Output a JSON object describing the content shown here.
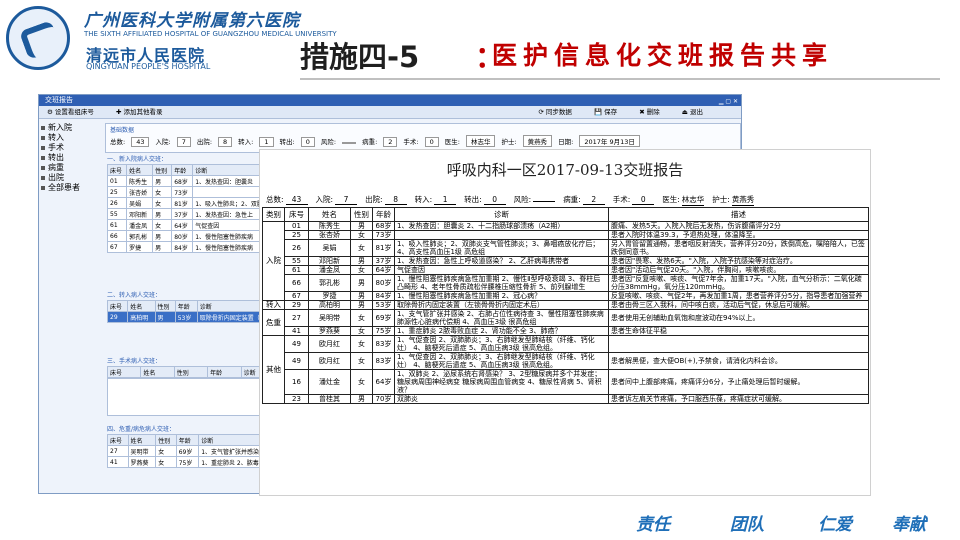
{
  "header": {
    "hospital_cn": "广州医科大学附属第六医院",
    "hospital_en": "THE SIXTH AFFILIATED HOSPITAL OF GUANGZHOU MEDICAL UNIVERSITY",
    "hospital_cn2": "清远市人民医院",
    "hospital_en2": "QINGYUAN PEOPLE'S HOSPITAL",
    "title_main": "措施四-5",
    "title_colon": "：",
    "title_sub": "医护信息化交班报告共享"
  },
  "app": {
    "window_title": "交班报告",
    "toolbar": {
      "set_bed": "设置看组床号",
      "add_content": "添加其他看录"
    },
    "toolbar_right": {
      "sync": "同步数据",
      "save": "保存",
      "delete": "删除",
      "close": "退出"
    },
    "tree": [
      "新入院",
      "转入",
      "手术",
      "转出",
      "病重",
      "出院",
      "全部患者"
    ],
    "stats_label": "基础数据",
    "stats": [
      {
        "label": "总数:",
        "value": "43"
      },
      {
        "label": "入院:",
        "value": "7"
      },
      {
        "label": "出院:",
        "value": "8"
      },
      {
        "label": "转入:",
        "value": "1"
      },
      {
        "label": "转出:",
        "value": "0"
      },
      {
        "label": "风险:",
        "value": ""
      },
      {
        "label": "病重:",
        "value": "2"
      },
      {
        "label": "手术:",
        "value": "0"
      },
      {
        "label": "医生:",
        "value": "林志华"
      },
      {
        "label": "护士:",
        "value": "黄燕秀"
      },
      {
        "label": "日期:",
        "value": "2017年 9月13日"
      }
    ],
    "sec1": {
      "title": "一、新入院病人交班：",
      "headers": [
        "床号",
        "姓名",
        "性别",
        "年龄",
        "诊断"
      ],
      "rows": [
        [
          "01",
          "陈秀生",
          "男",
          "68岁",
          "1、发热查因：胆囊炎"
        ],
        [
          "25",
          "张杏娇",
          "女",
          "73岁",
          ""
        ],
        [
          "26",
          "吴娟",
          "女",
          "81岁",
          "1、吸入性肺炎；2、双肺"
        ],
        [
          "55",
          "邓阳新",
          "男",
          "37岁",
          "1、发热查因：急性上"
        ],
        [
          "61",
          "潘金凤",
          "女",
          "64岁",
          "气促查因"
        ],
        [
          "66",
          "郭孔彬",
          "男",
          "80岁",
          "1、慢性阻塞性肺疾病"
        ],
        [
          "67",
          "罗捷",
          "男",
          "84岁",
          "1、慢性阻塞性肺疾病"
        ]
      ]
    },
    "sec2": {
      "title": "二、转入病人交班：",
      "headers": [
        "床号",
        "姓名",
        "性别",
        "年龄",
        "诊断"
      ],
      "rows": [
        [
          "29",
          "高柏明",
          "男",
          "53岁",
          "取除骨折内固定装置（"
        ]
      ]
    },
    "sec3": {
      "title": "三、手术病人交班：",
      "headers": [
        "床号",
        "姓名",
        "性别",
        "年龄",
        "诊断"
      ],
      "rows": []
    },
    "sec4": {
      "title": "四、危重/病危病人交班：",
      "headers": [
        "床号",
        "姓名",
        "性别",
        "年龄",
        "诊断"
      ],
      "rows": [
        [
          "27",
          "吴明带",
          "女",
          "69岁",
          "1、支气管扩张并感染"
        ],
        [
          "41",
          "罗燕葵",
          "女",
          "75岁",
          "1、重症肺炎 2、脓毒"
        ]
      ]
    }
  },
  "report": {
    "title": "呼吸内科一区2017-09-13交班报告",
    "stats": [
      {
        "label": "总数:",
        "value": "43"
      },
      {
        "label": "入院:",
        "value": "7"
      },
      {
        "label": "出院:",
        "value": "8"
      },
      {
        "label": "转入:",
        "value": "1"
      },
      {
        "label": "转出:",
        "value": "0"
      },
      {
        "label": "风险:",
        "value": ""
      },
      {
        "label": "病重:",
        "value": "2"
      },
      {
        "label": "手术:",
        "value": "0"
      },
      {
        "label": "医生:",
        "value": "林志华"
      },
      {
        "label": "护士:",
        "value": "黄燕秀"
      }
    ],
    "headers": [
      "类别",
      "床号",
      "姓名",
      "性别",
      "年龄",
      "诊断",
      "描述"
    ],
    "groups": [
      {
        "category": "入院",
        "rows": [
          {
            "bed": "01",
            "name": "陈秀生",
            "sex": "男",
            "age": "68岁",
            "dx": "1、发热查因：胆囊炎 2、十二指肠球部溃疡（A2期）",
            "desc": "腹痛、发热5天。入院入院后无发热，伤诉腹痛评分2分"
          },
          {
            "bed": "25",
            "name": "张杏娇",
            "sex": "女",
            "age": "73岁",
            "dx": "",
            "desc": "患者入院时体温39.3，予退热处理，体温降至。"
          },
          {
            "bed": "26",
            "name": "吴娟",
            "sex": "女",
            "age": "81岁",
            "dx": "1、吸入性肺炎；2、双肺炎支气管性肺炎；3、鼻咽癌放化疗后；4、高支性高血压1级 高危组",
            "desc": "另入胃管留置通畅，患者咽反射消失，营养评分20分，跌倒高危，嘱陪陪人，已签跌倒同意书。"
          },
          {
            "bed": "55",
            "name": "邓阳新",
            "sex": "男",
            "age": "37岁",
            "dx": "1、发热查因：急性上呼吸道感染？ 2、乙肝病毒携带者",
            "desc": "患者因\"畏寒、发热6天。\"入院，入院予抗感染等对症治疗。"
          },
          {
            "bed": "61",
            "name": "潘金凤",
            "sex": "女",
            "age": "64岁",
            "dx": "气促查因",
            "desc": "患者因\"活动后气促20天。\"入院，伴胸闷，咳嗽咳痰。"
          },
          {
            "bed": "66",
            "name": "郭孔彬",
            "sex": "男",
            "age": "80岁",
            "dx": "1、慢性阻塞性肺疾病急性加重期 2、慢性Ⅱ型呼吸衰竭 3、脊柱后凸畸形 4、老年性骨质疏松伴腰椎压缩性骨折 5、前列腺增生",
            "desc": "患者因\"反复咳嗽、咳痰、气促7年余，加重17天。\"入院，血气分析示：二氧化碳分压38mmHg，氧分压120mmHg。"
          },
          {
            "bed": "67",
            "name": "罗捷",
            "sex": "男",
            "age": "84岁",
            "dx": "1、慢性阻塞性肺疾病急性加重期 2、冠心病？",
            "desc": "反复咳嗽、咳痰、气促2年，再发加重1周，患者营养评分5分，指导患者加强营养"
          }
        ]
      },
      {
        "category": "转入",
        "rows": [
          {
            "bed": "29",
            "name": "高柏明",
            "sex": "男",
            "age": "53岁",
            "dx": "取除骨折内固定装置（左锁骨骨折内固定术后）",
            "desc": "患者由骨三区入我科，间中咳白痰，活动后气促，休息后可缓解。"
          }
        ]
      },
      {
        "category": "危重",
        "rows": [
          {
            "bed": "27",
            "name": "吴明带",
            "sex": "女",
            "age": "69岁",
            "dx": "1、支气管扩张并感染 2、右肺占位性病待查 3、慢性阻塞性肺疾病 肺源性心脏病代偿期 4、高血压3级 很高危组",
            "desc": "患者使用无创辅助血氧饱和度波动在94%以上。"
          },
          {
            "bed": "41",
            "name": "罗燕葵",
            "sex": "女",
            "age": "75岁",
            "dx": "1、重症肺炎 2脓毒败血症 2、肾功能不全 3、肺癌？",
            "desc": "患者生命体征平稳"
          }
        ]
      },
      {
        "category": "其他",
        "rows": [
          {
            "bed": "49",
            "name": "欧月红",
            "sex": "女",
            "age": "83岁",
            "dx": "1、气促查因 2、双肺肺炎；3、右肺继发型肺结核（纤维、钙化灶） 4、脑梗死后遗症 5、高血压病3级 很高危组。",
            "desc": ""
          },
          {
            "bed": "49",
            "name": "欧月红",
            "sex": "女",
            "age": "83岁",
            "dx": "1、气促查因 2、双肺肺炎；3、右肺继发型肺结核（纤维、钙化灶） 4、脑梗死后遗症 5、高血压病3级 很高危组。",
            "desc": "患者解黑便，查大便OB(+),予禁食，请消化内科会诊。"
          },
          {
            "bed": "16",
            "name": "潘灶金",
            "sex": "女",
            "age": "64岁",
            "dx": "1、双肺炎 2、泌尿系统右肾感染？ 3、2型糖尿病并多个并发症；糖尿病周围神经病变 糖尿病周围血管病变 4、糖尿性肾病 5、肾积液？",
            "desc": "患者间中上腹部疼痛，疼痛评分6分，予止痛处理后暂时缓解。"
          },
          {
            "bed": "23",
            "name": "曾桂其",
            "sex": "男",
            "age": "70岁",
            "dx": "双肺炎",
            "desc": "患者诉左肩关节疼痛，予口服西乐葆，疼痛症状可缓解。"
          }
        ]
      }
    ]
  },
  "footer": {
    "mottos": [
      "责任",
      "团队",
      "仁爱",
      "奉献"
    ]
  },
  "colors": {
    "brand_blue": "#1c5a9c",
    "title_red": "#c00000",
    "motto_blue": "#1f6fb8",
    "app_titlebar": "#2f5fb3"
  }
}
